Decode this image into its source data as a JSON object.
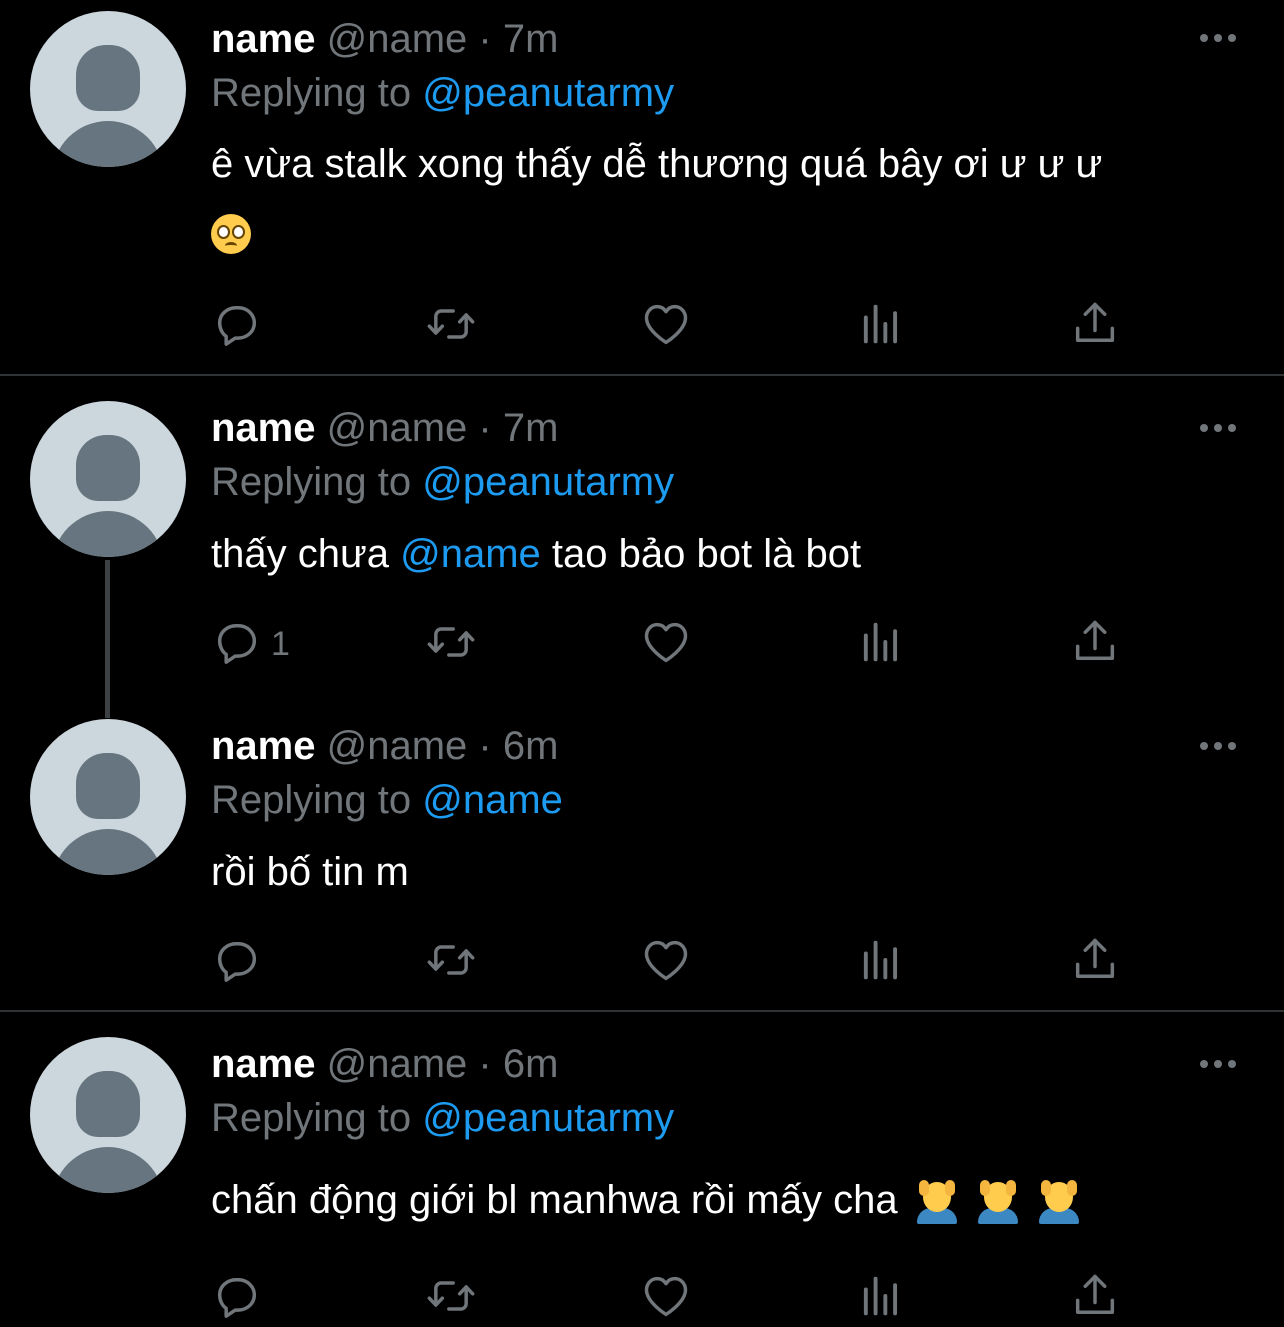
{
  "tweets": [
    {
      "name": "name",
      "handle": "@name",
      "dot": "·",
      "time": "7m",
      "replying_prefix": "Replying to",
      "replying_to": "@peanutarmy",
      "text": "ê vừa stalk xong thấy dễ thương quá bây ơi ư ư ư",
      "emoji": "pleading-face",
      "reply_count": ""
    },
    {
      "name": "name",
      "handle": "@name",
      "dot": "·",
      "time": "7m",
      "replying_prefix": "Replying to",
      "replying_to": "@peanutarmy",
      "text_before": "thấy chưa",
      "text_mention": "@name",
      "text_after": "tao bảo bot là bot",
      "reply_count": "1"
    },
    {
      "name": "name",
      "handle": "@name",
      "dot": "·",
      "time": "6m",
      "replying_prefix": "Replying to",
      "replying_to": "@name",
      "text": "rồi bố tin m",
      "reply_count": ""
    },
    {
      "name": "name",
      "handle": "@name",
      "dot": "·",
      "time": "6m",
      "replying_prefix": "Replying to",
      "replying_to": "@peanutarmy",
      "text": "chấn động giới bl manhwa rồi mấy cha",
      "emoji": "person-getting-massage",
      "reply_count": ""
    }
  ],
  "icons": {
    "reply": "reply-icon",
    "retweet": "retweet-icon",
    "like": "like-icon",
    "analytics": "analytics-icon",
    "share": "share-icon",
    "more": "more-icon"
  },
  "colors": {
    "background": "#000000",
    "accent": "#1d9bf0",
    "muted": "#71767b",
    "divider": "#2f3336",
    "avatar_bg": "#ccd6dd",
    "avatar_fg": "#66757f"
  }
}
